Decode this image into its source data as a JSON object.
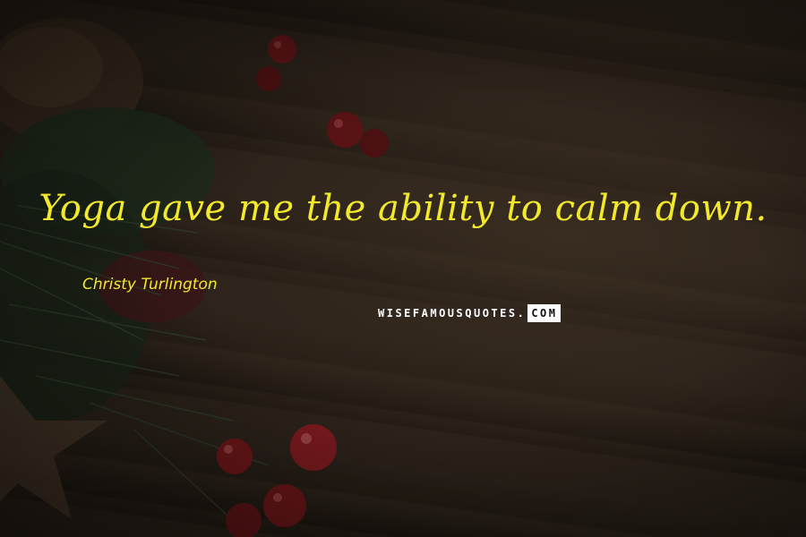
{
  "quote": {
    "text": "Yoga gave me the ability to calm down.",
    "author": "Christy Turlington"
  },
  "watermark": {
    "main": "WISEFAMOUSQUOTES.",
    "suffix": "COM"
  },
  "colors": {
    "quote_text": "#f2e82c",
    "background": "#2a2119",
    "berries": "#7a1a1e"
  }
}
